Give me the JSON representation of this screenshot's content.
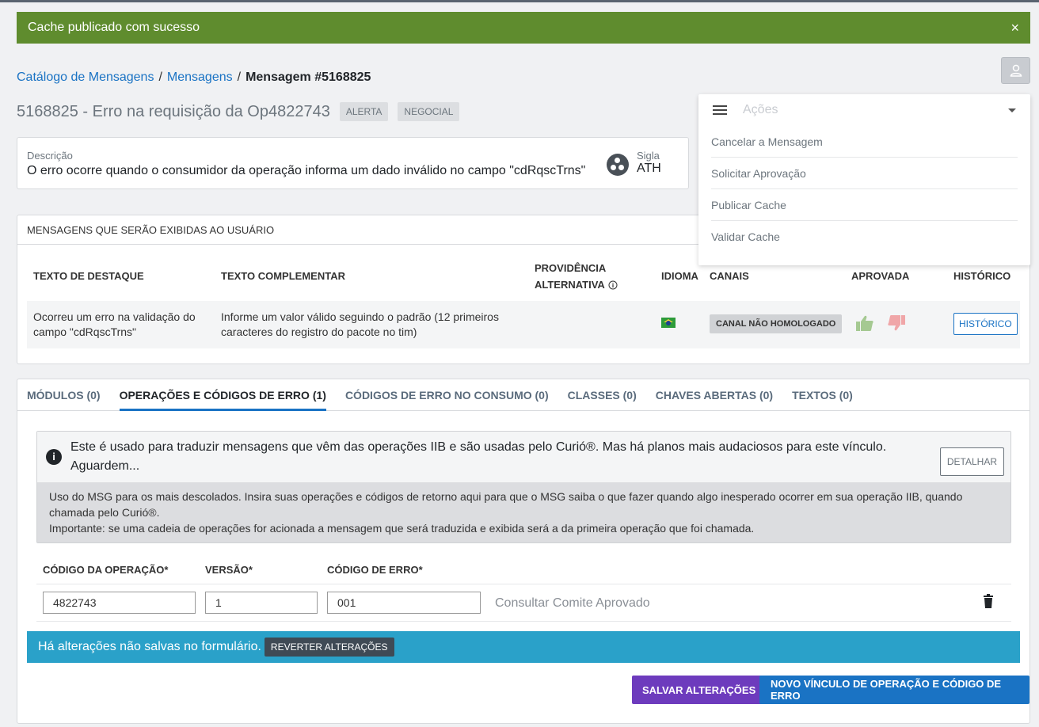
{
  "alert": {
    "message": "Cache publicado com sucesso",
    "close": "×"
  },
  "breadcrumb": {
    "item1": "Catálogo de Mensagens",
    "sep": "/",
    "item2": "Mensagens",
    "current": "Mensagem #5168825"
  },
  "title": {
    "text": "5168825 - Erro na requisição da Op4822743",
    "tag1": "ALERTA",
    "tag2": "NEGOCIAL"
  },
  "description": {
    "label": "Descrição",
    "value": "O erro ocorre quando o consumidor da operação informa um dado inválido no campo \"cdRqscTrns\"",
    "sigla_label": "Sigla",
    "sigla_value": "ATH"
  },
  "actions": {
    "placeholder": "Ações",
    "items": [
      "Cancelar a Mensagem",
      "Solicitar Aprovação",
      "Publicar Cache",
      "Validar Cache"
    ]
  },
  "messages": {
    "header": "MENSAGENS QUE SERÃO EXIBIDAS AO USUÁRIO",
    "columns": {
      "destaque": "TEXTO DE DESTAQUE",
      "complementar": "TEXTO COMPLEMENTAR",
      "providencia1": "PROVIDÊNCIA",
      "providencia2": "ALTERNATIVA",
      "idioma": "IDIOMA",
      "canais": "CANAIS",
      "aprovada": "APROVADA",
      "historico": "HISTÓRICO"
    },
    "row": {
      "destaque1": "Ocorreu um erro na validação do",
      "destaque2": "campo \"cdRqscTrns\"",
      "complementar1": "Informe um valor válido seguindo o padrão (12 primeiros",
      "complementar2": "caracteres do registro do pacote no tim)",
      "canal": "CANAL NÃO HOMOLOGADO",
      "historico_btn": "HISTÓRICO"
    }
  },
  "tabs": [
    "MÓDULOS (0)",
    "OPERAÇÕES E CÓDIGOS DE ERRO (1)",
    "CÓDIGOS DE ERRO NO CONSUMO (0)",
    "CLASSES (0)",
    "CHAVES ABERTAS (0)",
    "TEXTOS (0)"
  ],
  "info": {
    "line1": "Este é usado para traduzir mensagens que vêm das operações IIB e são usadas pelo Curió®. Mas há planos mais audaciosos para este vínculo.",
    "line2": "Aguardem...",
    "detalhar": "DETALHAR",
    "body1": "Uso do MSG para os mais descolados. Insira suas operações e códigos de retorno aqui para que o MSG saiba o que fazer quando algo inesperado ocorrer em sua operação IIB, quando",
    "body2": "chamada pelo Curió®.",
    "body3": "Importante: se uma cadeia de operações for acionada a mensagem que será traduzida e exibida será a da primeira operação que foi chamada."
  },
  "operations": {
    "columns": {
      "codigo": "CÓDIGO DA OPERAÇÃO*",
      "versao": "VERSÃO*",
      "erro": "CÓDIGO DE ERRO*"
    },
    "row": {
      "codigo": "4822743",
      "versao": "1",
      "erro": "001",
      "consult": "Consultar Comite Aprovado"
    }
  },
  "unsaved": {
    "message": "Há alterações não salvas no formulário.",
    "revert": "REVERTER ALTERAÇÕES"
  },
  "buttons": {
    "save": "SALVAR ALTERAÇÕES",
    "new": "NOVO VÍNCULO DE OPERAÇÃO E CÓDIGO DE ERRO"
  }
}
